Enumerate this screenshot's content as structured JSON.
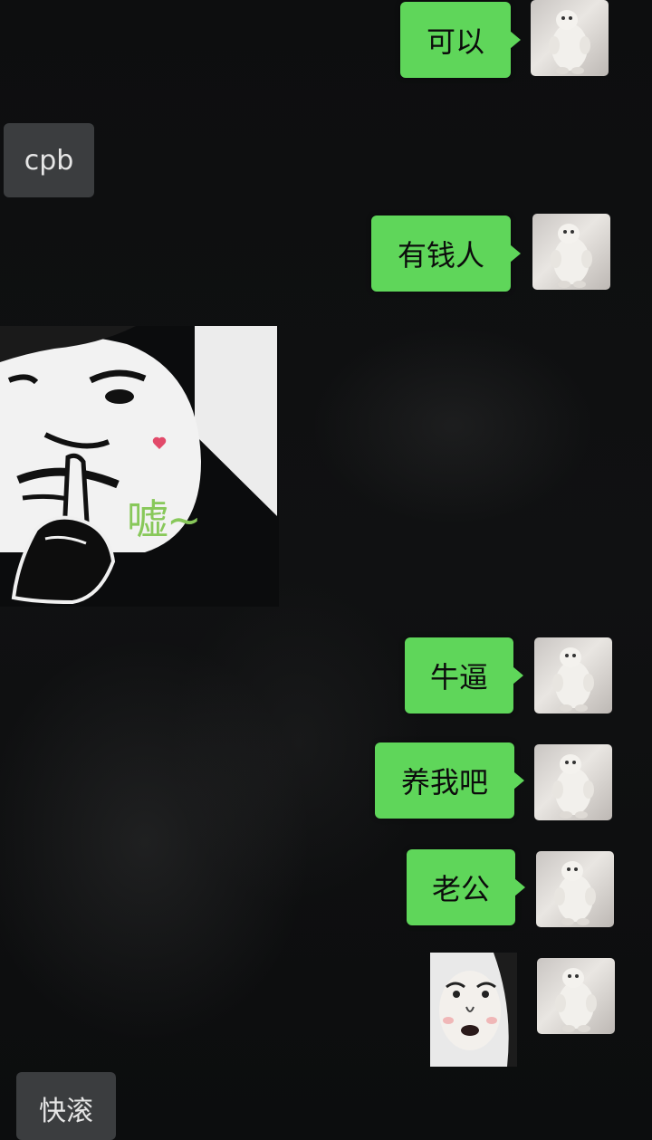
{
  "chat": {
    "messages": [
      {
        "side": "out",
        "text": "可以"
      },
      {
        "side": "in",
        "text": "cpb"
      },
      {
        "side": "out",
        "text": "有钱人"
      },
      {
        "side": "in",
        "sticker": "shush-face",
        "sticker_text": "嘘~"
      },
      {
        "side": "out",
        "text": "牛逼"
      },
      {
        "side": "out",
        "text": "养我吧"
      },
      {
        "side": "out",
        "text": "老公"
      },
      {
        "side": "out",
        "sticker": "face"
      },
      {
        "side": "in",
        "text": "快滚"
      }
    ]
  },
  "colors": {
    "outgoing_bubble": "#5fd65a",
    "incoming_bubble": "#3b3d3f",
    "background": "#0b0c0d"
  },
  "icons": {
    "self_avatar": "stuffed-dinosaur-avatar"
  }
}
